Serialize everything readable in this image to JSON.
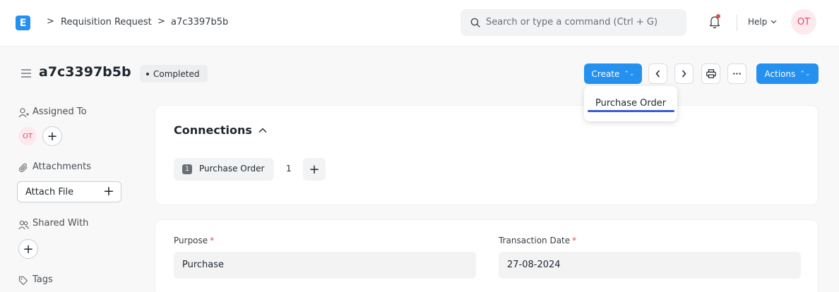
{
  "navbar": {
    "logo_letter": "E",
    "breadcrumbs": [
      "Requisition Request",
      "a7c3397b5b"
    ],
    "separator": ">",
    "search_placeholder": "Search or type a command (Ctrl + G)",
    "help_label": "Help",
    "user_initials": "OT"
  },
  "header": {
    "title": "a7c3397b5b",
    "status": "Completed",
    "create_label": "Create",
    "actions_label": "Actions",
    "more_label": "···",
    "sort_glyph": "⌃⌄"
  },
  "dropdown": {
    "items": [
      "Purchase Order"
    ]
  },
  "sidebar": {
    "assigned_to_label": "Assigned To",
    "assignee_initials": "OT",
    "attachments_label": "Attachments",
    "attach_file_label": "Attach File",
    "shared_with_label": "Shared With",
    "tags_label": "Tags",
    "plus": "+"
  },
  "connections": {
    "title": "Connections",
    "items": [
      {
        "badge": "1",
        "label": "Purchase Order",
        "count": "1"
      }
    ],
    "add": "+"
  },
  "form": {
    "fields": [
      {
        "label": "Purpose",
        "required_mark": "*",
        "value": "Purchase"
      },
      {
        "label": "Transaction Date",
        "required_mark": "*",
        "value": "27-08-2024"
      }
    ]
  },
  "colors": {
    "primary": "#2490ef",
    "avatar_bg": "#fde9ee",
    "avatar_text": "#e04b6e",
    "required": "#e24c4c"
  }
}
